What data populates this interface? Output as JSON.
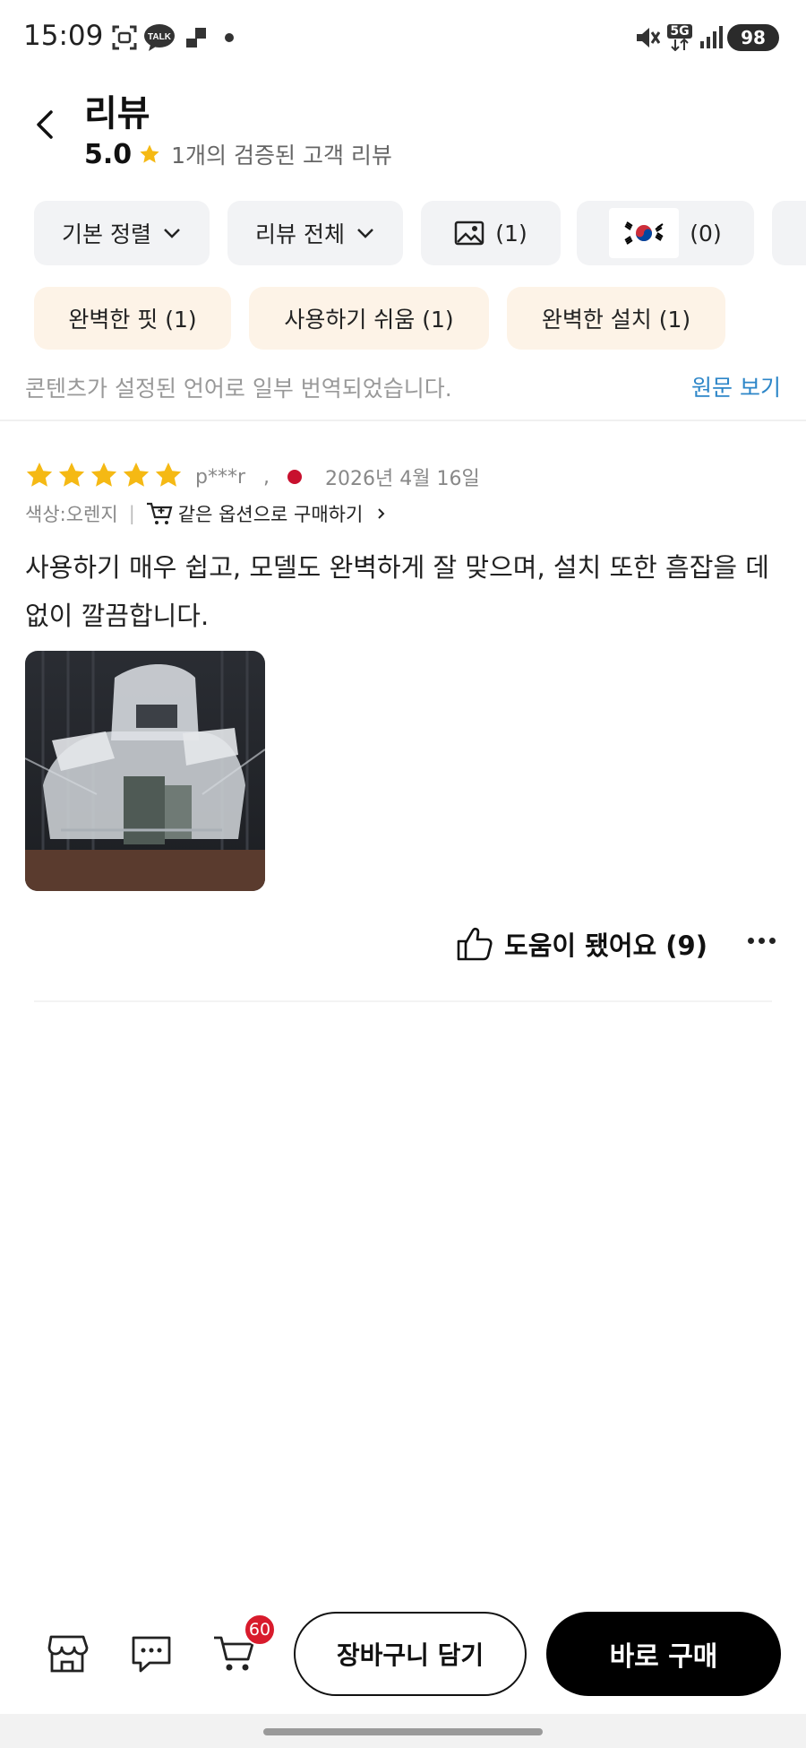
{
  "status_bar": {
    "time": "15:09",
    "talk_label": "TALK",
    "network": "5G",
    "battery": "98"
  },
  "header": {
    "title": "리뷰",
    "rating": "5.0",
    "review_count_text": "1개의 검증된 고객 리뷰"
  },
  "filters": {
    "sort_label": "기본 정렬",
    "review_scope_label": "리뷰 전체",
    "photo_count": "(1)",
    "korean_count": "(0)"
  },
  "tags": [
    {
      "label": "완벽한 핏 (1)"
    },
    {
      "label": "사용하기 쉬움 (1)"
    },
    {
      "label": "완벽한 설치 (1)"
    }
  ],
  "translation": {
    "notice": "콘텐츠가 설정된 언어로 일부 번역되었습니다.",
    "view_original": "원문 보기"
  },
  "review": {
    "stars": 5,
    "reviewer": "p***r",
    "separator": ",",
    "date": "2026년 4월 16일",
    "option": "색상:오렌지",
    "divider": "|",
    "buy_same": "같은 옵션으로 구매하기",
    "text": "사용하기 매우 쉽고, 모델도 완벽하게 잘 맞으며, 설치 또한 흠잡을 데 없이 깔끔합니다.",
    "helpful_label": "도움이 됐어요 (9)"
  },
  "bottom_bar": {
    "cart_badge": "60",
    "add_to_cart": "장바구니 담기",
    "buy_now": "바로 구매"
  },
  "colors": {
    "star": "#f5b914",
    "tag_bg": "#fdf3e7",
    "chip_bg": "#f2f3f5",
    "link": "#2d86c8",
    "badge": "#d81b2c"
  }
}
